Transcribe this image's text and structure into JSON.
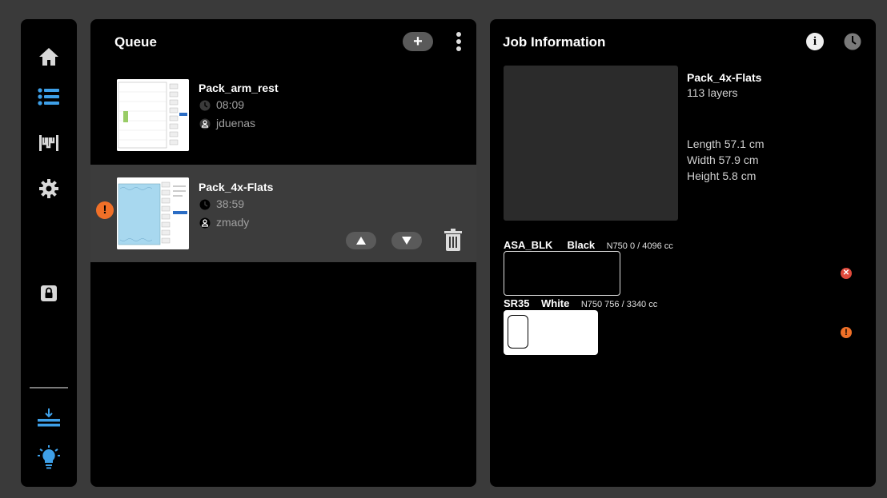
{
  "sidebar": {
    "items": [
      {
        "name": "home",
        "icon": "home-icon"
      },
      {
        "name": "queue",
        "icon": "list-icon",
        "active": true
      },
      {
        "name": "printer",
        "icon": "printer-icon"
      },
      {
        "name": "settings",
        "icon": "gear-icon"
      },
      {
        "name": "lock",
        "icon": "lock-icon"
      },
      {
        "name": "load",
        "icon": "load-icon"
      },
      {
        "name": "light",
        "icon": "bulb-icon"
      }
    ],
    "accent_color": "#3ea0e8"
  },
  "queue": {
    "title": "Queue",
    "add_label": "+",
    "jobs": [
      {
        "name": "Pack_arm_rest",
        "time": "08:09",
        "user": "jduenas",
        "selected": false,
        "warning": false
      },
      {
        "name": "Pack_4x-Flats",
        "time": "38:59",
        "user": "zmady",
        "selected": true,
        "warning": true,
        "warning_label": "!"
      }
    ]
  },
  "job_info": {
    "title": "Job Information",
    "info_label": "i",
    "name": "Pack_4x-Flats",
    "layers": "113 layers",
    "length": "Length 57.1 cm",
    "width": "Width 57.9 cm",
    "height": "Height 5.8 cm",
    "materials": [
      {
        "code": "ASA_BLK",
        "color_name": "Black",
        "detail": "N750 0 / 4096 cc",
        "status": "error",
        "status_label": "✕",
        "swatch": "#000000"
      },
      {
        "code": "SR35",
        "color_name": "White",
        "detail": "N750 756 / 3340 cc",
        "status": "warning",
        "status_label": "!",
        "swatch": "#ffffff"
      }
    ]
  },
  "colors": {
    "warning": "#f07028",
    "error": "#e04a3c",
    "panel": "#000000",
    "background": "#3a3a3a"
  }
}
